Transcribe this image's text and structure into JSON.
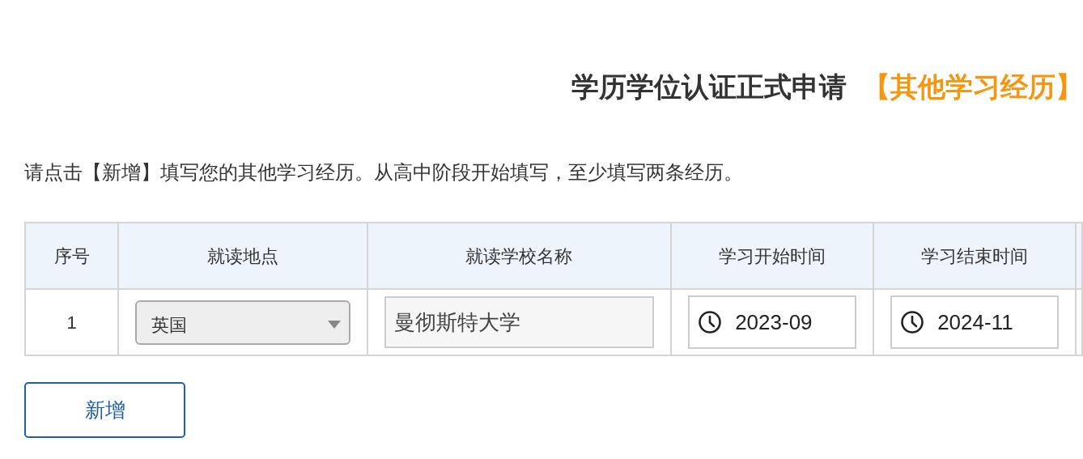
{
  "title": {
    "text": "学历学位认证正式申请",
    "highlight": "【其他学习经历】"
  },
  "instruction": "请点击【新增】填写您的其他学习经历。从高中阶段开始填写，至少填写两条经历。",
  "table": {
    "columns": [
      "序号",
      "就读地点",
      "就读学校名称",
      "学习开始时间",
      "学习结束时间"
    ],
    "rows": [
      {
        "cells": [
          {
            "kind": "text",
            "value": "1"
          },
          {
            "kind": "select",
            "value": "英国"
          },
          {
            "kind": "input",
            "value": "曼彻斯特大学"
          },
          {
            "kind": "date",
            "value": "2023-09"
          },
          {
            "kind": "date",
            "value": "2024-11"
          }
        ]
      }
    ]
  },
  "add_button": "新增"
}
